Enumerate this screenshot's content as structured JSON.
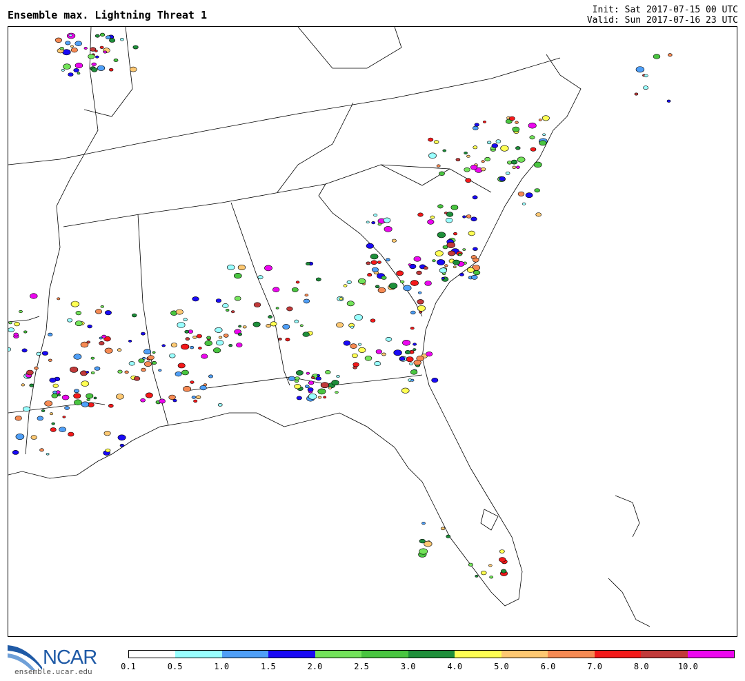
{
  "header": {
    "title": "Ensemble max. Lightning Threat 1",
    "init": "Init: Sat 2017-07-15 00 UTC",
    "valid": "Valid: Sun 2017-07-16 23 UTC"
  },
  "logo": {
    "text": "NCAR",
    "url": "ensemble.ucar.edu",
    "color": "#1f5aa6"
  },
  "colorbar": {
    "colors": [
      "#ffffff",
      "#99ffff",
      "#4f9ff7",
      "#1a0af5",
      "#73e35a",
      "#49c540",
      "#1e8f3a",
      "#ffff53",
      "#fdc872",
      "#f68a53",
      "#f3191a",
      "#c13a3a",
      "#ec07ef"
    ],
    "labels": [
      "0.1",
      "0.5",
      "1.0",
      "1.5",
      "2.0",
      "2.5",
      "3.0",
      "4.0",
      "5.0",
      "6.0",
      "7.0",
      "8.0",
      "10.0"
    ]
  }
}
